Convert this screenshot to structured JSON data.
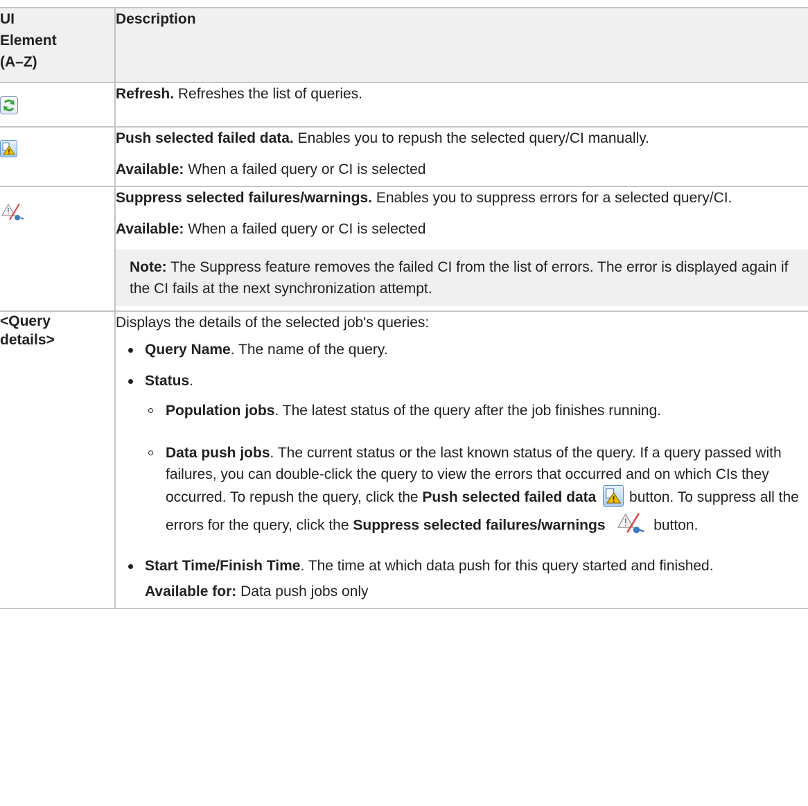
{
  "header": {
    "col1": "UI Element (A–Z)",
    "col2": "Description"
  },
  "rows": {
    "refresh": {
      "icon": "refresh-icon",
      "title": "Refresh.",
      "text": " Refreshes the list of queries."
    },
    "push": {
      "icon": "push-failed-data-icon",
      "title": "Push selected failed data.",
      "text": " Enables you to repush the selected query/CI manually.",
      "avail_label": "Available:",
      "avail_text": " When a failed query or CI is selected"
    },
    "suppress": {
      "icon": "suppress-failures-icon",
      "title": "Suppress selected failures/warnings.",
      "text": " Enables you to suppress errors for a selected query/CI.",
      "avail_label": "Available:",
      "avail_text": " When a failed query or CI is selected",
      "note_label": "Note:",
      "note_text": " The Suppress feature removes the failed CI from the list of errors. The error is displayed again if the CI fails at the next synchronization attempt."
    },
    "query": {
      "name": "<Query details>",
      "intro": "Displays the details of the selected job's queries:",
      "item1_label": "Query Name",
      "item1_text": ". The name of the query.",
      "item2_label": "Status",
      "item2_text": ".",
      "sub1_label": "Population jobs",
      "sub1_text": ". The latest status of the query after the job finishes running.",
      "sub2_label": "Data push jobs",
      "sub2_text": ". The current status or the last known status of the query. If a query passed with failures, you can double-click the query to view the errors that occurred and on which CIs they occurred. To repush the query, click the ",
      "sub2_push_label": "Push selected failed data",
      "sub2_mid": " button. To suppress all the errors for the query, click the ",
      "sub2_suppress_label": "Suppress selected failures/warnings",
      "sub2_end": " button.",
      "item3_label": "Start Time/Finish Time",
      "item3_text": ". The time at which data push for this query started and finished.",
      "avail_label": "Available for:",
      "avail_text": " Data push jobs only"
    }
  },
  "colors": {
    "border": "#c4c4c4",
    "header_bg": "#f0f0f0",
    "note_bg": "#f0f0f0",
    "refresh_green": "#3aa63a",
    "warning_yellow": "#f2c200"
  }
}
